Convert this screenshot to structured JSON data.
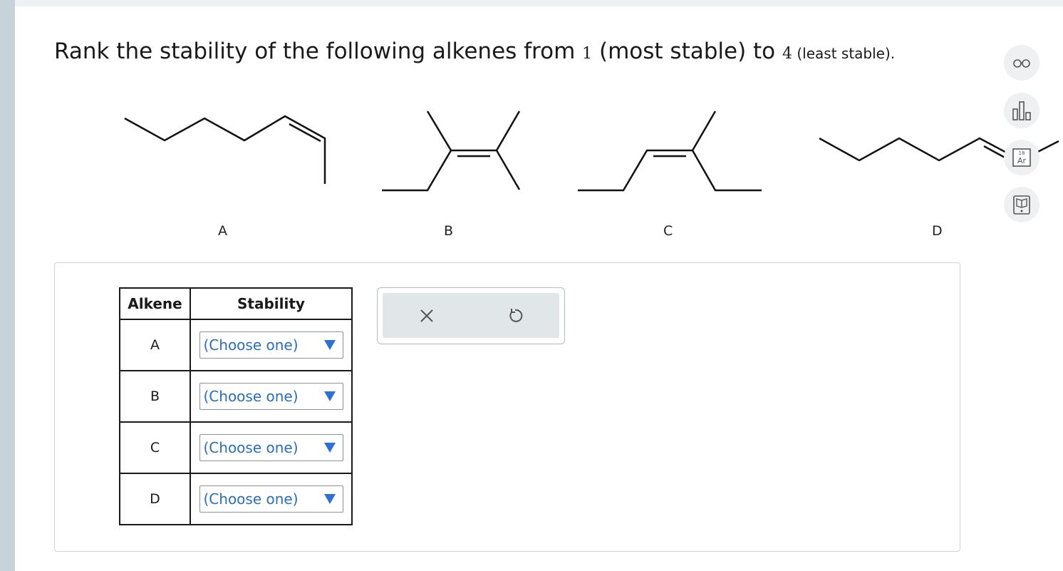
{
  "question": {
    "prefix": "Rank the stability of the following alkenes from ",
    "most_num": "1",
    "most_text": " (most stable) to ",
    "least_num": "4",
    "least_text": " (least stable)."
  },
  "molecules": [
    {
      "label": "A"
    },
    {
      "label": "B"
    },
    {
      "label": "C"
    },
    {
      "label": "D"
    }
  ],
  "table": {
    "header_alkene": "Alkene",
    "header_stability": "Stability",
    "rows": [
      {
        "alkene": "A",
        "stability": "(Choose one)"
      },
      {
        "alkene": "B",
        "stability": "(Choose one)"
      },
      {
        "alkene": "C",
        "stability": "(Choose one)"
      },
      {
        "alkene": "D",
        "stability": "(Choose one)"
      }
    ]
  },
  "side_tools": [
    {
      "icon": "glasses-icon"
    },
    {
      "icon": "bar-chart-icon"
    },
    {
      "icon": "periodic-table-icon",
      "text_top": "18",
      "text_bottom": "Ar"
    },
    {
      "icon": "ebook-icon"
    }
  ],
  "actions": {
    "clear": "close-icon",
    "undo": "undo-icon"
  },
  "colors": {
    "link_blue": "#2a6ebb",
    "arrow_blue": "#2f6fd8",
    "left_strip": "#c7d2d9"
  }
}
